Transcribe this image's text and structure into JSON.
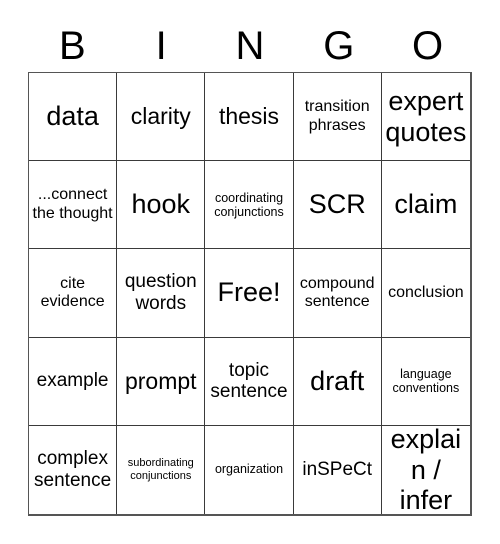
{
  "card": {
    "title": "BINGO",
    "header_letters": [
      "B",
      "I",
      "N",
      "G",
      "O"
    ],
    "free_space_label": "Free!",
    "colors": {
      "background": "#ffffff",
      "text": "#000000",
      "grid_line": "#3a3a3a",
      "grid_outer": "#555555"
    },
    "grid": {
      "rows": 5,
      "columns": 5,
      "cells": [
        {
          "text": "data",
          "size": "sz-xl",
          "lines": 1
        },
        {
          "text": "clarity",
          "size": "sz-lg",
          "lines": 1
        },
        {
          "text": "thesis",
          "size": "sz-lg",
          "lines": 1
        },
        {
          "text": "transition phrases",
          "size": "sz-sm",
          "lines": 2
        },
        {
          "text": "expert quotes",
          "size": "sz-xl",
          "lines": 2
        },
        {
          "text": "...connect the thought",
          "size": "sz-sm",
          "lines": 3
        },
        {
          "text": "hook",
          "size": "sz-xl",
          "lines": 1
        },
        {
          "text": "coordinating conjunctions",
          "size": "sz-xs",
          "lines": 2
        },
        {
          "text": "SCR",
          "size": "sz-xl",
          "lines": 1
        },
        {
          "text": "claim",
          "size": "sz-xl",
          "lines": 1
        },
        {
          "text": "cite evidence",
          "size": "sz-sm",
          "lines": 2
        },
        {
          "text": "question words",
          "size": "sz-md",
          "lines": 2
        },
        {
          "text": "Free!",
          "size": "sz-xl",
          "lines": 1
        },
        {
          "text": "compound sentence",
          "size": "sz-sm",
          "lines": 2
        },
        {
          "text": "conclusion",
          "size": "sz-sm",
          "lines": 1
        },
        {
          "text": "example",
          "size": "sz-md",
          "lines": 1
        },
        {
          "text": "prompt",
          "size": "sz-lg",
          "lines": 1
        },
        {
          "text": "topic sentence",
          "size": "sz-md",
          "lines": 2
        },
        {
          "text": "draft",
          "size": "sz-xl",
          "lines": 1
        },
        {
          "text": "language conventions",
          "size": "sz-xs",
          "lines": 2
        },
        {
          "text": "complex sentence",
          "size": "sz-md",
          "lines": 2
        },
        {
          "text": "subordinating conjunctions",
          "size": "sz-xxs",
          "lines": 2
        },
        {
          "text": "organization",
          "size": "sz-xs",
          "lines": 1
        },
        {
          "text": "inSPeCt",
          "size": "sz-md",
          "lines": 1
        },
        {
          "text": "explain / infer",
          "size": "sz-xl",
          "lines": 2
        }
      ]
    }
  }
}
